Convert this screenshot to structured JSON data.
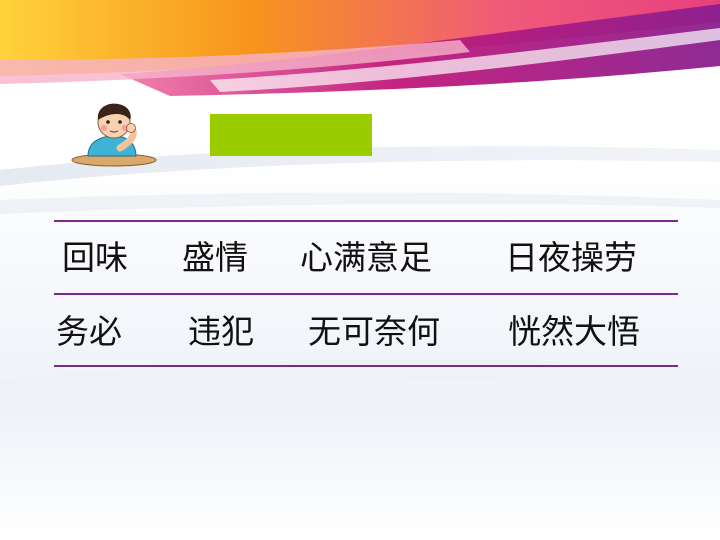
{
  "rows": [
    {
      "words": [
        "回味",
        "盛情",
        "心满意足",
        "日夜操劳"
      ]
    },
    {
      "words": [
        "务必",
        "违犯",
        "无可奈何",
        "恍然大悟"
      ]
    }
  ],
  "colors": {
    "accent_green": "#9bcc00",
    "rule_purple": "#7a2a8a",
    "text": "#111111",
    "banner_orange": "#f7941d",
    "banner_magenta": "#c2187a"
  },
  "icons": {
    "cartoon": "thinking-boy-illustration"
  }
}
